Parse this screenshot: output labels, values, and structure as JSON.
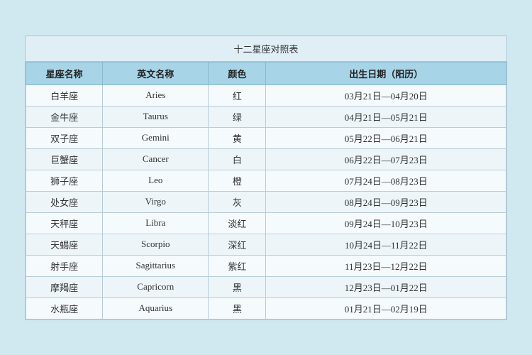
{
  "title": "十二星座对照表",
  "headers": {
    "zh_name": "星座名称",
    "en_name": "英文名称",
    "color": "颜色",
    "date": "出生日期（阳历）"
  },
  "rows": [
    {
      "zh": "白羊座",
      "en": "Aries",
      "color": "红",
      "date": "03月21日—04月20日"
    },
    {
      "zh": "金牛座",
      "en": "Taurus",
      "color": "绿",
      "date": "04月21日—05月21日"
    },
    {
      "zh": "双子座",
      "en": "Gemini",
      "color": "黄",
      "date": "05月22日—06月21日"
    },
    {
      "zh": "巨蟹座",
      "en": "Cancer",
      "color": "白",
      "date": "06月22日—07月23日"
    },
    {
      "zh": "狮子座",
      "en": "Leo",
      "color": "橙",
      "date": "07月24日—08月23日"
    },
    {
      "zh": "处女座",
      "en": "Virgo",
      "color": "灰",
      "date": "08月24日—09月23日"
    },
    {
      "zh": "天秤座",
      "en": "Libra",
      "color": "淡红",
      "date": "09月24日—10月23日"
    },
    {
      "zh": "天蝎座",
      "en": "Scorpio",
      "color": "深红",
      "date": "10月24日—11月22日"
    },
    {
      "zh": "射手座",
      "en": "Sagittarius",
      "color": "紫红",
      "date": "11月23日—12月22日"
    },
    {
      "zh": "摩羯座",
      "en": "Capricorn",
      "color": "黑",
      "date": "12月23日—01月22日"
    },
    {
      "zh": "水瓶座",
      "en": "Aquarius",
      "color": "黑",
      "date": "01月21日—02月19日"
    }
  ]
}
